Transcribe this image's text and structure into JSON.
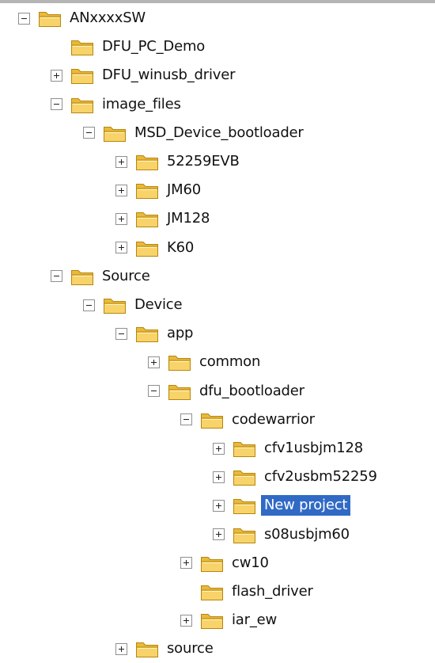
{
  "tree": [
    {
      "label": "ANxxxxSW",
      "depth": 0,
      "state": "expanded"
    },
    {
      "label": "DFU_PC_Demo",
      "depth": 1,
      "state": "none"
    },
    {
      "label": "DFU_winusb_driver",
      "depth": 1,
      "state": "collapsed"
    },
    {
      "label": "image_files",
      "depth": 1,
      "state": "expanded"
    },
    {
      "label": "MSD_Device_bootloader",
      "depth": 2,
      "state": "expanded"
    },
    {
      "label": "52259EVB",
      "depth": 3,
      "state": "collapsed"
    },
    {
      "label": "JM60",
      "depth": 3,
      "state": "collapsed"
    },
    {
      "label": "JM128",
      "depth": 3,
      "state": "collapsed"
    },
    {
      "label": "K60",
      "depth": 3,
      "state": "collapsed"
    },
    {
      "label": "Source",
      "depth": 1,
      "state": "expanded"
    },
    {
      "label": "Device",
      "depth": 2,
      "state": "expanded"
    },
    {
      "label": "app",
      "depth": 3,
      "state": "expanded"
    },
    {
      "label": "common",
      "depth": 4,
      "state": "collapsed"
    },
    {
      "label": "dfu_bootloader",
      "depth": 4,
      "state": "expanded"
    },
    {
      "label": "codewarrior",
      "depth": 5,
      "state": "expanded"
    },
    {
      "label": "cfv1usbjm128",
      "depth": 6,
      "state": "collapsed"
    },
    {
      "label": "cfv2usbm52259",
      "depth": 6,
      "state": "collapsed"
    },
    {
      "label": "New project",
      "depth": 6,
      "state": "collapsed",
      "selected": true
    },
    {
      "label": "s08usbjm60",
      "depth": 6,
      "state": "collapsed"
    },
    {
      "label": "cw10",
      "depth": 5,
      "state": "collapsed"
    },
    {
      "label": "flash_driver",
      "depth": 5,
      "state": "none"
    },
    {
      "label": "iar_ew",
      "depth": 5,
      "state": "collapsed"
    },
    {
      "label": "source",
      "depth": 3,
      "state": "collapsed"
    }
  ],
  "colors": {
    "selection": "#316ac5",
    "folder_fill": "#f7d36a",
    "folder_outline": "#b8860b"
  },
  "icons": {
    "folder": "folder-icon",
    "expand": "plus-box-icon",
    "collapse": "minus-box-icon"
  }
}
